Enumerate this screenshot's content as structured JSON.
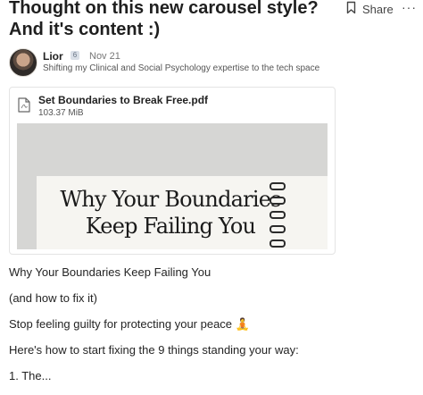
{
  "post": {
    "title": "Thought on this new carousel style? And it's content :)",
    "share_label": "Share",
    "more_label": "···"
  },
  "author": {
    "name": "Lior",
    "badge": "6",
    "date": "Nov 21",
    "bio": "Shifting my Clinical and Social Psychology expertise to the tech space"
  },
  "attachment": {
    "file_name": "Set Boundaries to Break Free.pdf",
    "file_size": "103.37 MiB",
    "preview_line1": "Why Your Boundaries",
    "preview_line2": "Keep Failing You"
  },
  "body": {
    "paragraphs": [
      "Why Your Boundaries Keep Failing You",
      "(and how to fix it)",
      "Stop feeling guilty for protecting your peace 🧘",
      "Here's how to start fixing the 9 things standing your way:",
      "1. The..."
    ]
  },
  "icons": {
    "bookmark": "bookmark-icon",
    "more": "more-options-icon",
    "pdf": "pdf-file-icon"
  }
}
